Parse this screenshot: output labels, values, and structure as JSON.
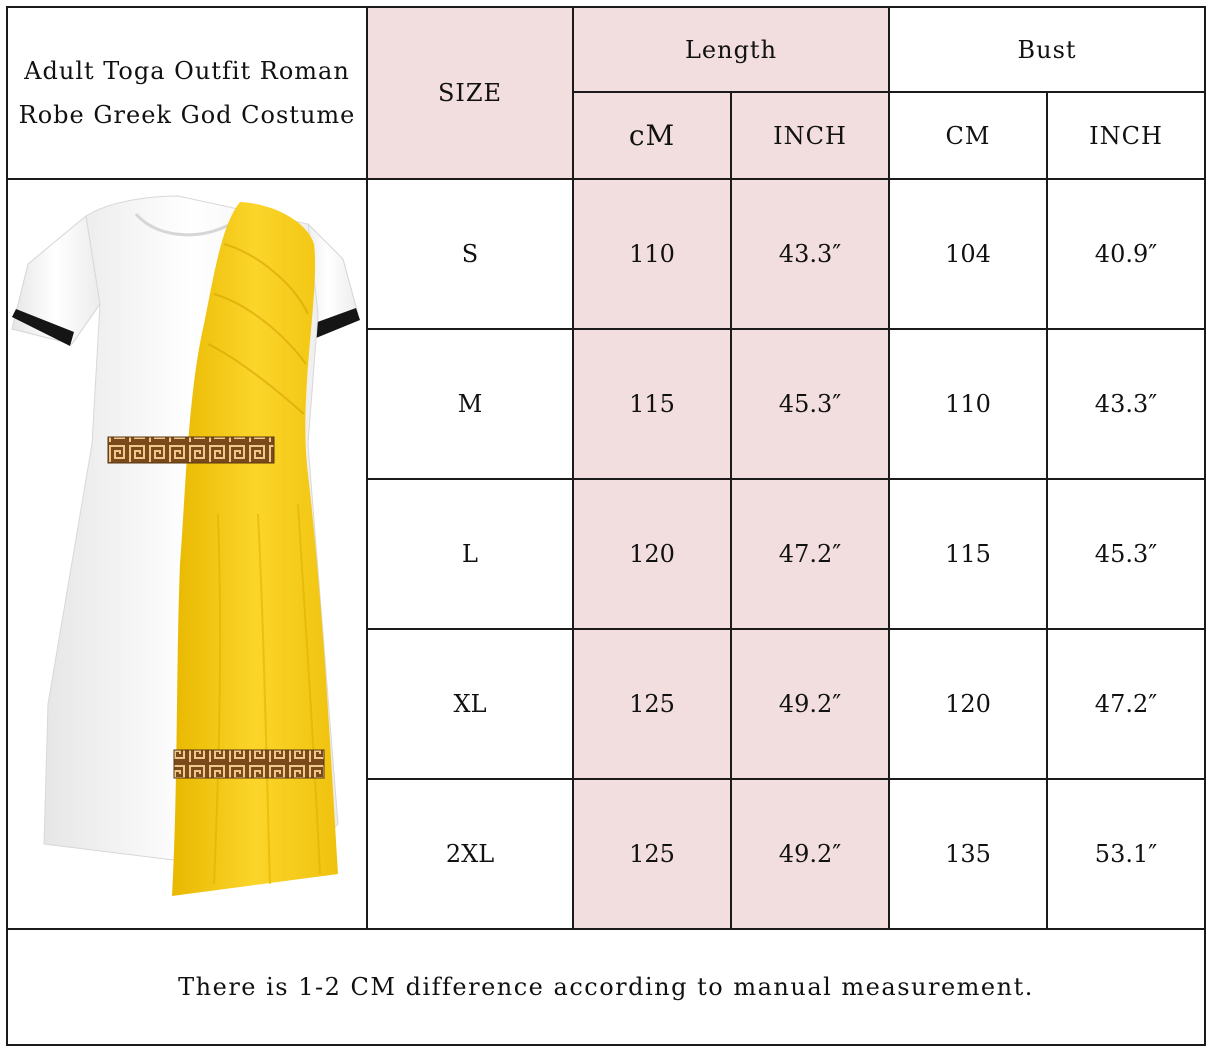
{
  "title": "Adult Toga Outfit Roman Robe Greek God Costume",
  "headers": {
    "size": "SIZE",
    "length": "Length",
    "bust": "Bust",
    "length_cm": "cM",
    "length_inch": "INCH",
    "bust_cm": "CM",
    "bust_inch": "INCH"
  },
  "rows": [
    {
      "size": "S",
      "length_cm": "110",
      "length_inch": "43.3″",
      "bust_cm": "104",
      "bust_inch": "40.9″"
    },
    {
      "size": "M",
      "length_cm": "115",
      "length_inch": "45.3″",
      "bust_cm": "110",
      "bust_inch": "43.3″"
    },
    {
      "size": "L",
      "length_cm": "120",
      "length_inch": "47.2″",
      "bust_cm": "115",
      "bust_inch": "45.3″"
    },
    {
      "size": "XL",
      "length_cm": "125",
      "length_inch": "49.2″",
      "bust_cm": "120",
      "bust_inch": "47.2″"
    },
    {
      "size": "2XL",
      "length_cm": "125",
      "length_inch": "49.2″",
      "bust_cm": "135",
      "bust_inch": "53.1″"
    }
  ],
  "note": "There is 1-2 CM difference according to manual measurement.",
  "colors": {
    "header_pink": "#f2dede",
    "drape_yellow": "#f7cf1e",
    "robe_white": "#f8f8f8",
    "trim_black": "#151515",
    "belt_gold": "#b9823a"
  },
  "image": {
    "subject": "toga-costume-illustration"
  }
}
